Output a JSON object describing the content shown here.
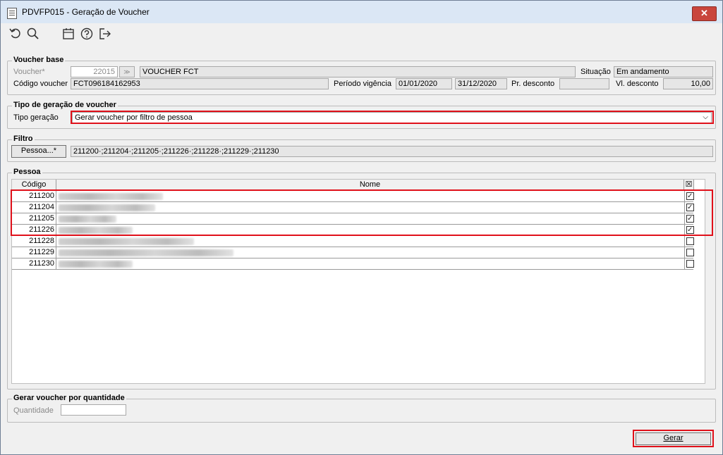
{
  "window": {
    "title": "PDVFP015 - Geração de Voucher",
    "close_glyph": "✕"
  },
  "toolbar": {
    "icons": [
      "undo-icon",
      "search-icon",
      "calendar-icon",
      "help-icon",
      "exit-icon"
    ]
  },
  "voucher_base": {
    "legend": "Voucher base",
    "voucher_label": "Voucher*",
    "voucher_value": "22015",
    "voucher_desc": "VOUCHER FCT",
    "situacao_label": "Situação",
    "situacao_value": "Em andamento",
    "codigo_label": "Código voucher",
    "codigo_value": "FCT096184162953",
    "periodo_label": "Período vigência",
    "periodo_inicio": "01/01/2020",
    "periodo_fim": "31/12/2020",
    "pr_desconto_label": "Pr. desconto",
    "pr_desconto_value": "",
    "vl_desconto_label": "Vl. desconto",
    "vl_desconto_value": "10,00"
  },
  "tipo_geracao": {
    "legend": "Tipo de geração de voucher",
    "label": "Tipo geração",
    "value": "Gerar voucher por filtro de pessoa"
  },
  "filtro": {
    "legend": "Filtro",
    "button_label": "Pessoa...*",
    "value": "211200·;211204·;211205·;211226·;211228·;211229·;211230"
  },
  "pessoa": {
    "legend": "Pessoa",
    "columns": {
      "codigo": "Código",
      "nome": "Nome",
      "check": "☒"
    },
    "rows": [
      {
        "codigo": "211200",
        "checked": true
      },
      {
        "codigo": "211204",
        "checked": true
      },
      {
        "codigo": "211205",
        "checked": true
      },
      {
        "codigo": "211226",
        "checked": true
      },
      {
        "codigo": "211228",
        "checked": false
      },
      {
        "codigo": "211229",
        "checked": false
      },
      {
        "codigo": "211230",
        "checked": false
      }
    ]
  },
  "quantidade": {
    "legend": "Gerar voucher por quantidade",
    "label": "Quantidade",
    "value": ""
  },
  "footer": {
    "gerar_label": "Gerar"
  },
  "colors": {
    "highlight": "#e0101a",
    "title_bar": "#dbe7f5",
    "close": "#c9463d"
  }
}
